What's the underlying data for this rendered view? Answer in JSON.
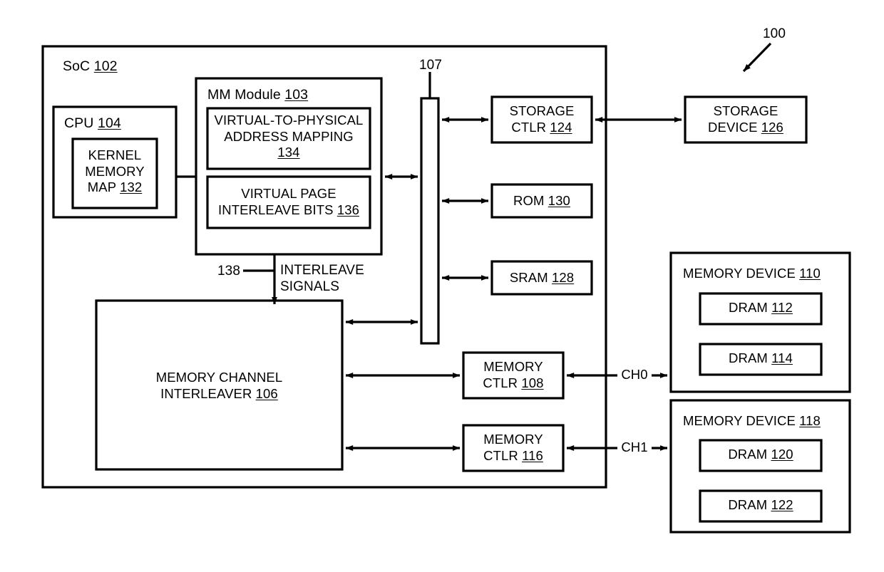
{
  "figure": {
    "reference_numeral": "100",
    "soc": {
      "title": "SoC",
      "numeral": "102"
    },
    "cpu": {
      "title": "CPU",
      "numeral": "104",
      "kernel_memory_map": {
        "label": "KERNEL\nMEMORY\nMAP",
        "numeral": "132"
      }
    },
    "mm_module": {
      "title": "MM Module",
      "numeral": "103",
      "virtual_to_physical": {
        "label": "VIRTUAL-TO-PHYSICAL\nADDRESS MAPPING",
        "numeral": "134"
      },
      "virtual_page_interleave_bits": {
        "label": "VIRTUAL PAGE\nINTERLEAVE BITS",
        "numeral": "136"
      }
    },
    "bus": {
      "numeral": "107"
    },
    "interleave_signals": {
      "numeral": "138",
      "label": "INTERLEAVE\nSIGNALS"
    },
    "memory_channel_interleaver": {
      "label": "MEMORY CHANNEL\nINTERLEAVER",
      "numeral": "106"
    },
    "storage_ctlr": {
      "label": "STORAGE\nCTLR",
      "numeral": "124"
    },
    "rom": {
      "label": "ROM",
      "numeral": "130"
    },
    "sram": {
      "label": "SRAM",
      "numeral": "128"
    },
    "storage_device": {
      "label": "STORAGE\nDEVICE",
      "numeral": "126"
    },
    "memory_ctlr_0": {
      "label": "MEMORY\nCTLR",
      "numeral": "108"
    },
    "memory_ctlr_1": {
      "label": "MEMORY\nCTLR",
      "numeral": "116"
    },
    "channels": [
      {
        "label": "CH0"
      },
      {
        "label": "CH1"
      }
    ],
    "memory_device_0": {
      "label": "MEMORY DEVICE",
      "numeral": "110",
      "drams": [
        {
          "label": "DRAM",
          "numeral": "112"
        },
        {
          "label": "DRAM",
          "numeral": "114"
        }
      ]
    },
    "memory_device_1": {
      "label": "MEMORY DEVICE",
      "numeral": "118",
      "drams": [
        {
          "label": "DRAM",
          "numeral": "120"
        },
        {
          "label": "DRAM",
          "numeral": "122"
        }
      ]
    },
    "colors": {
      "stroke": "#000000",
      "background": "#ffffff"
    }
  }
}
